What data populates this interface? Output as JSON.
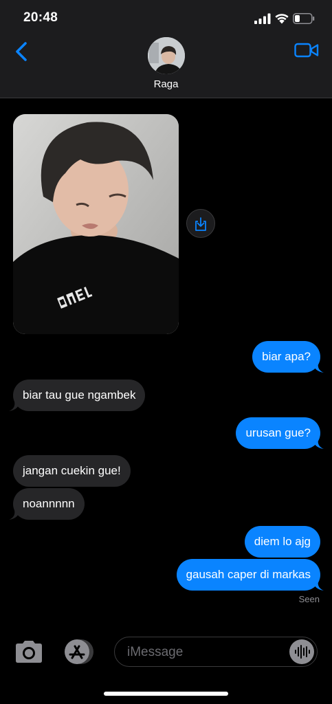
{
  "status_bar": {
    "time": "20:48"
  },
  "header": {
    "contact_name": "Raga"
  },
  "photo": {
    "shirt_text": "JENO"
  },
  "messages": [
    {
      "side": "sent",
      "text": "biar apa?"
    },
    {
      "side": "received",
      "text": "biar tau gue ngambek"
    },
    {
      "side": "sent",
      "text": "urusan gue?"
    },
    {
      "side": "received",
      "text": "jangan cuekin gue!"
    },
    {
      "side": "received",
      "text": "noannnnn"
    },
    {
      "side": "sent",
      "text": "diem lo ajg"
    },
    {
      "side": "sent",
      "text": "gausah caper di markas"
    }
  ],
  "receipt": "Seen",
  "composer": {
    "placeholder": "iMessage"
  },
  "colors": {
    "accent": "#0a84ff",
    "received_bubble": "#262628",
    "background": "#000000",
    "bar": "#1c1c1e"
  }
}
